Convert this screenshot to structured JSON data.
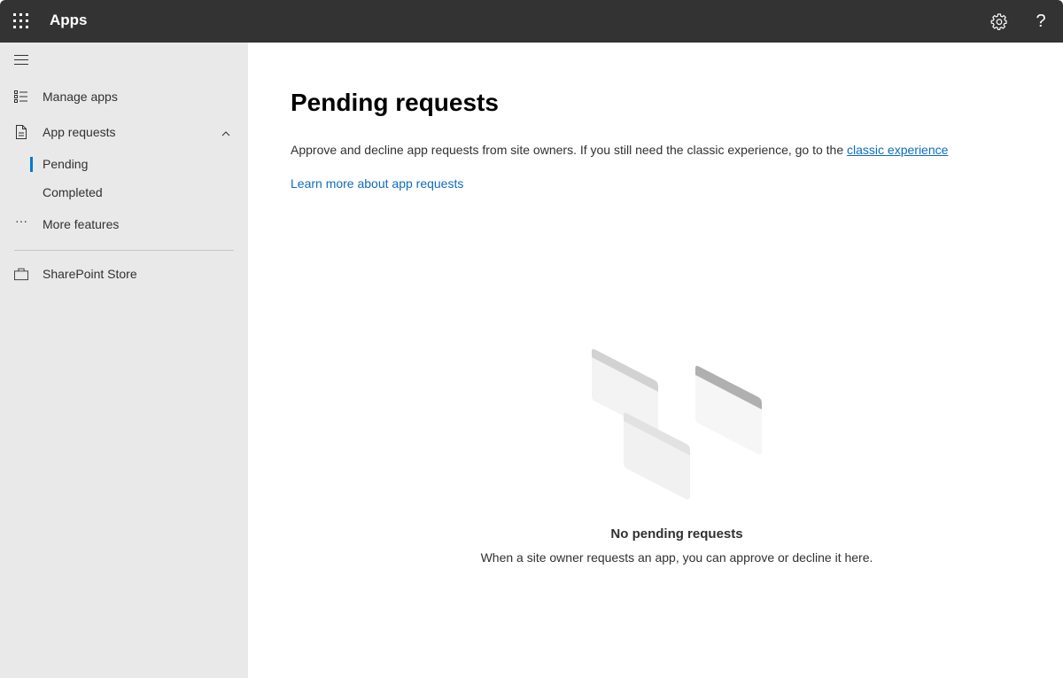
{
  "header": {
    "app_title": "Apps",
    "icons": [
      "waffle-icon",
      "gear-icon",
      "help-icon"
    ],
    "help_glyph": "?"
  },
  "sidebar": {
    "items": [
      {
        "label": "Manage apps",
        "icon": "list-icon"
      },
      {
        "label": "App requests",
        "icon": "document-icon",
        "expanded": true,
        "children": [
          {
            "label": "Pending",
            "active": true
          },
          {
            "label": "Completed",
            "active": false
          }
        ]
      },
      {
        "label": "More features",
        "icon": "ellipsis-icon",
        "glyph": "···"
      },
      {
        "label": "SharePoint Store",
        "icon": "shopping-bag-icon"
      }
    ]
  },
  "main": {
    "title": "Pending requests",
    "description": "Approve and decline app requests from site owners. If you still need the classic experience, go to the ",
    "classic_link": "classic experience",
    "learn_more": "Learn more about app requests",
    "empty_title": "No pending requests",
    "empty_subtitle": "When a site owner requests an app, you can approve or decline it here."
  },
  "colors": {
    "topbar": "#333333",
    "sidebar": "#e9e9e9",
    "accent": "#0078d4",
    "link": "#0f6cbd"
  }
}
